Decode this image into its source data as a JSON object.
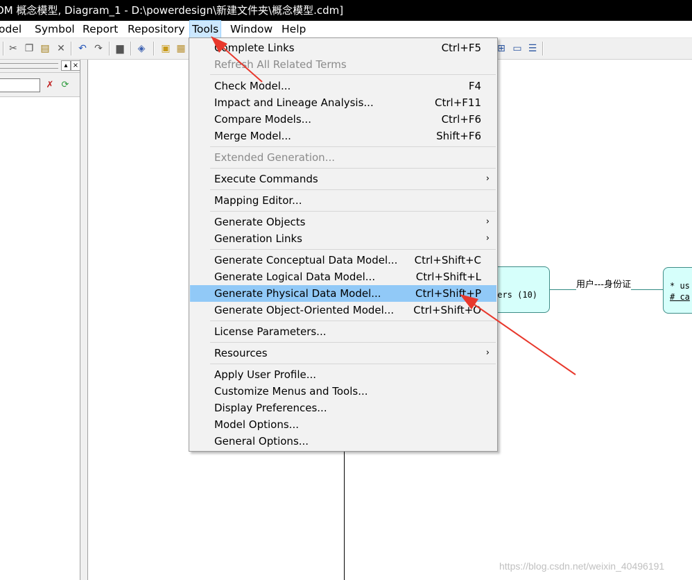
{
  "title": "OM 概念模型, Diagram_1 - D:\\powerdesign\\新建文件夹\\概念模型.cdm]",
  "menubar": [
    "odel",
    "Symbol",
    "Report",
    "Repository",
    "Tools",
    "Window",
    "Help"
  ],
  "tools_menu": {
    "complete_links": {
      "label": "Complete Links",
      "shortcut": "Ctrl+F5"
    },
    "refresh_terms": {
      "label": "Refresh All Related Terms"
    },
    "check_model": {
      "label": "Check Model...",
      "shortcut": "F4"
    },
    "impact_lineage": {
      "label": "Impact and Lineage Analysis...",
      "shortcut": "Ctrl+F11"
    },
    "compare_models": {
      "label": "Compare Models...",
      "shortcut": "Ctrl+F6"
    },
    "merge_model": {
      "label": "Merge Model...",
      "shortcut": "Shift+F6"
    },
    "extended_generation": {
      "label": "Extended Generation..."
    },
    "execute_commands": {
      "label": "Execute Commands",
      "arrow": "›"
    },
    "mapping_editor": {
      "label": "Mapping Editor..."
    },
    "generate_objects": {
      "label": "Generate Objects",
      "arrow": "›"
    },
    "generation_links": {
      "label": "Generation Links",
      "arrow": "›"
    },
    "gen_conceptual": {
      "label": "Generate Conceptual Data Model...",
      "shortcut": "Ctrl+Shift+C"
    },
    "gen_logical": {
      "label": "Generate Logical Data Model...",
      "shortcut": "Ctrl+Shift+L"
    },
    "gen_physical": {
      "label": "Generate Physical Data Model...",
      "shortcut": "Ctrl+Shift+P"
    },
    "gen_oo": {
      "label": "Generate Object-Oriented Model...",
      "shortcut": "Ctrl+Shift+O"
    },
    "license_params": {
      "label": "License Parameters..."
    },
    "resources": {
      "label": "Resources",
      "arrow": "›"
    },
    "apply_profile": {
      "label": "Apply User Profile..."
    },
    "customize_menus": {
      "label": "Customize Menus and Tools..."
    },
    "display_prefs": {
      "label": "Display Preferences..."
    },
    "model_options": {
      "label": "Model Options..."
    },
    "general_options": {
      "label": "General Options..."
    }
  },
  "diagram": {
    "entity1_text": "ters (10)",
    "relationship_label": "用户---身份证",
    "entity2_line1": "* us",
    "entity2_line2": "# ca"
  },
  "watermark": "https://blog.csdn.net/weixin_40496191",
  "colors": {
    "highlight": "#91c9f7",
    "entity_fill": "#d6fffb",
    "arrow": "#e8382c"
  }
}
